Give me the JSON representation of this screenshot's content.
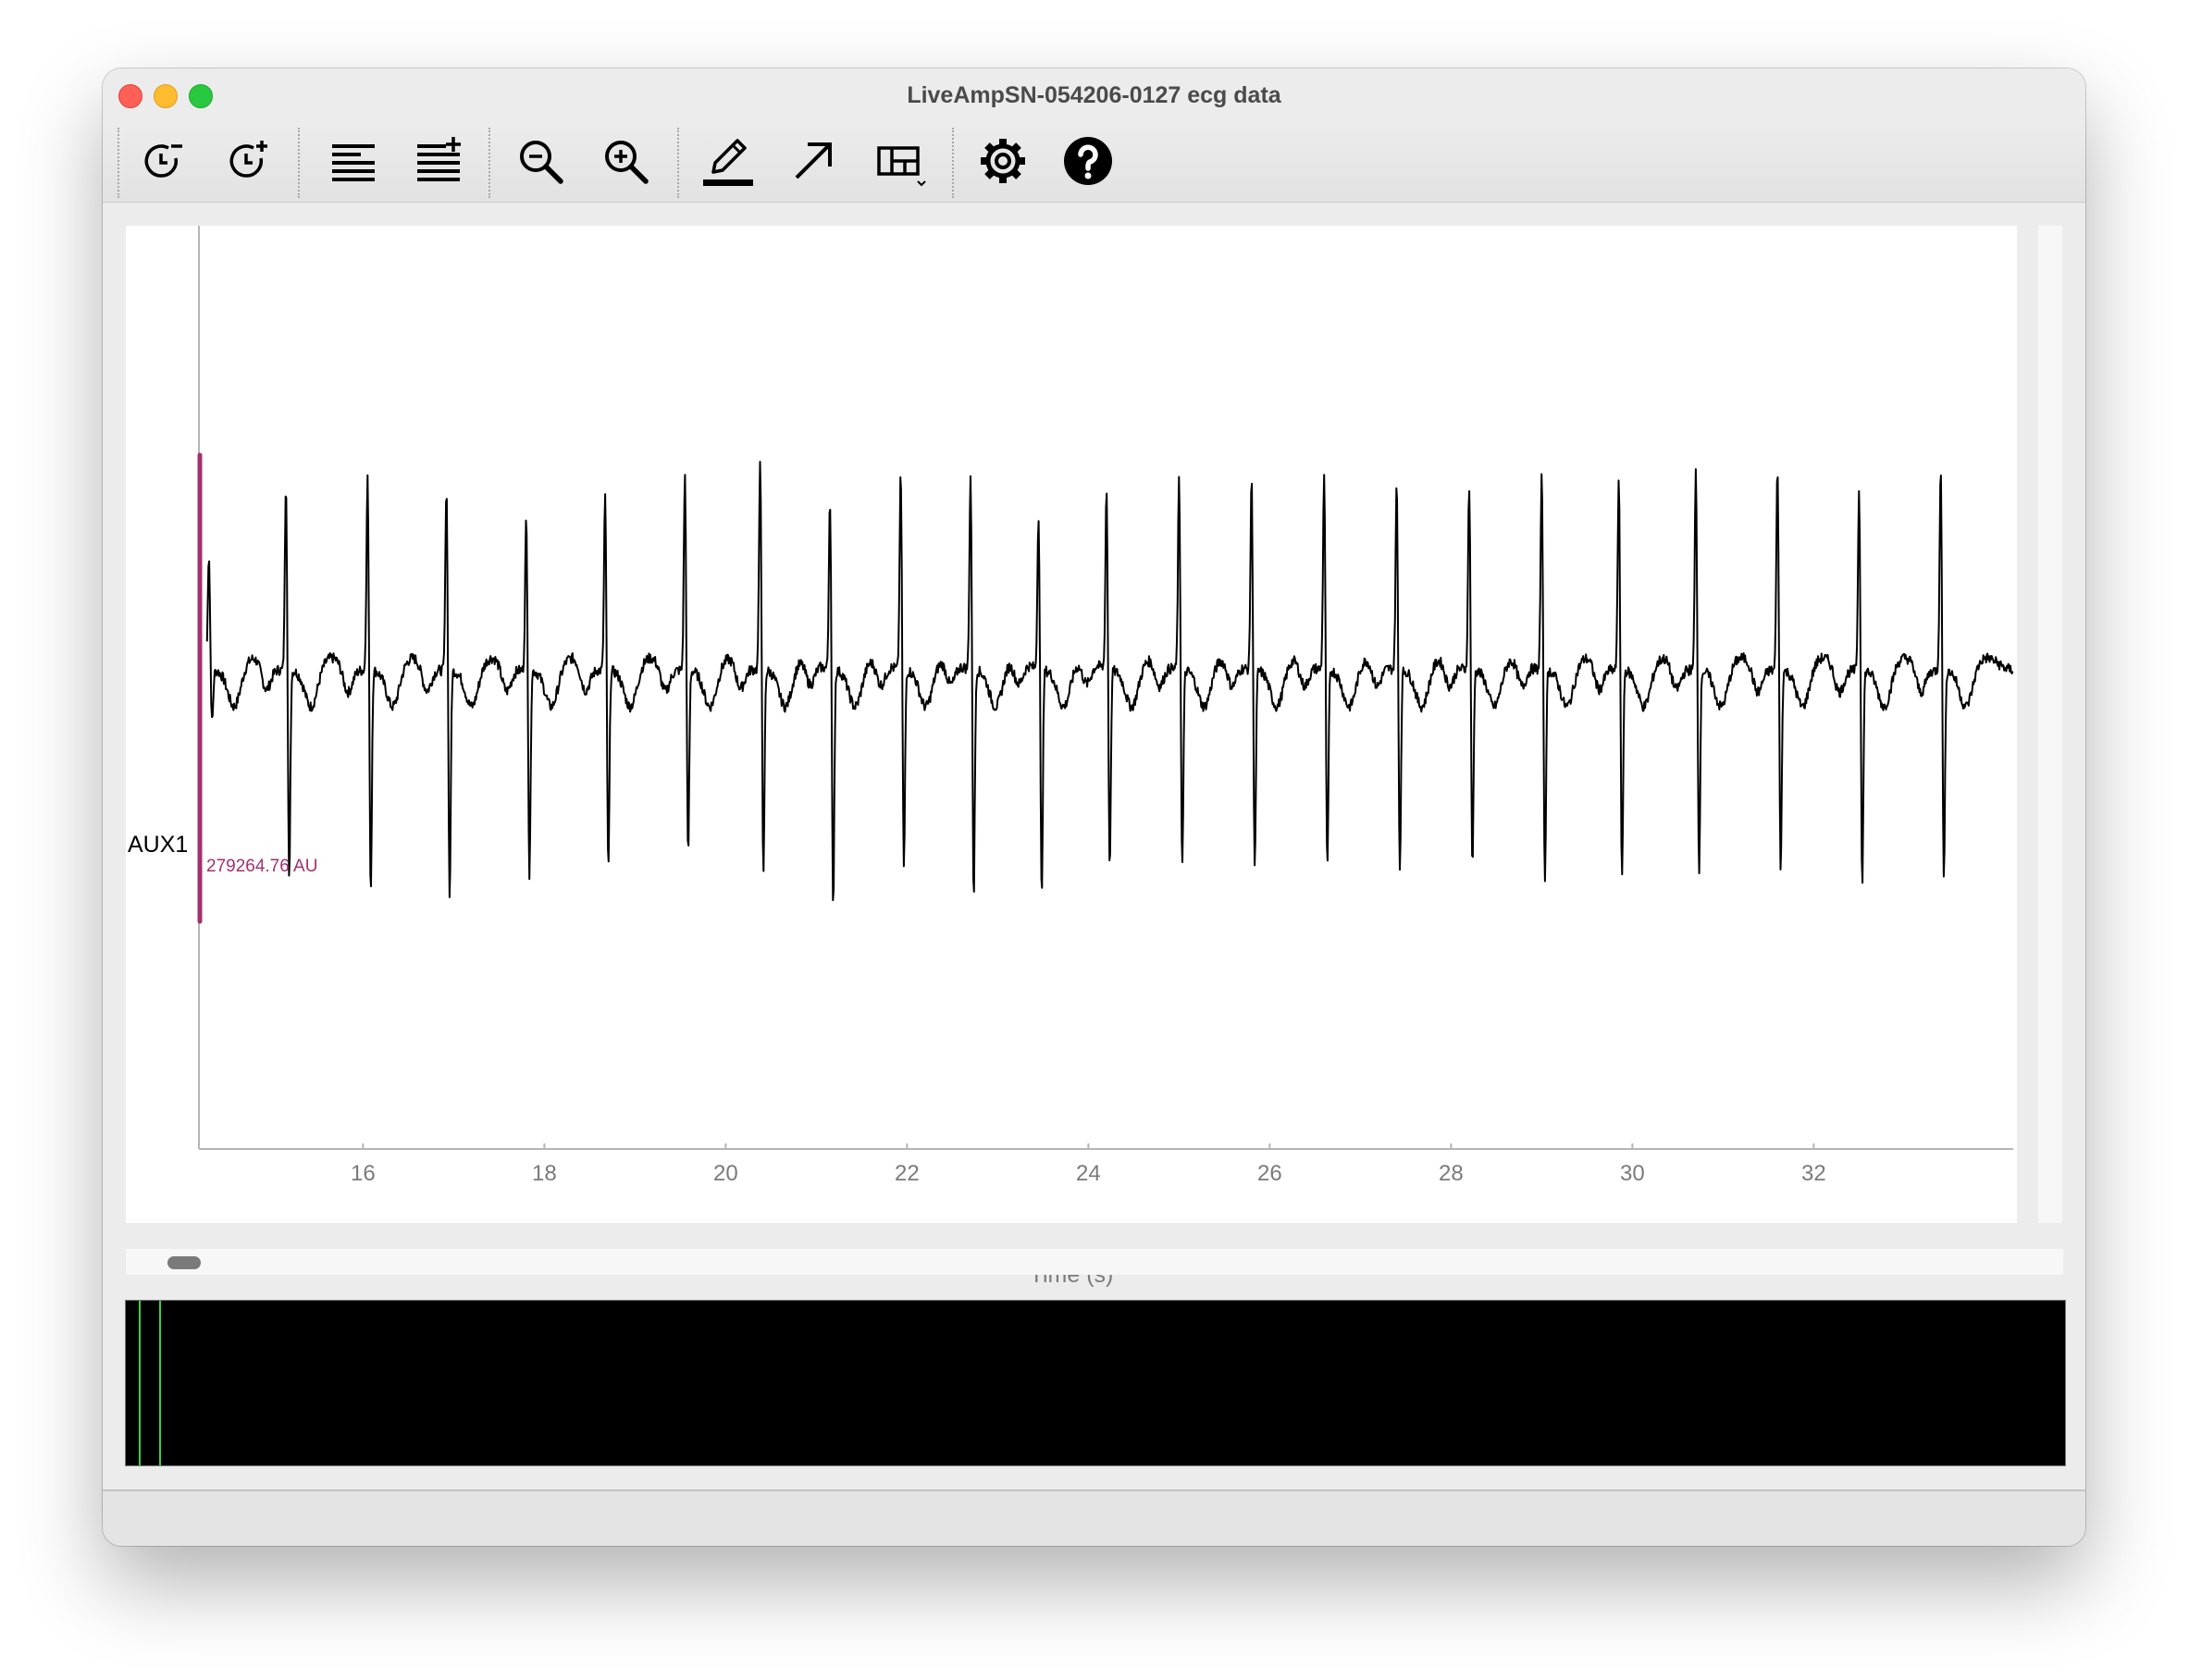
{
  "window": {
    "title": "LiveAmpSN-054206-0127 ecg data"
  },
  "toolbar": {
    "buttons": [
      {
        "name": "decrease-time-scale-button",
        "icon": "clock-minus-icon"
      },
      {
        "name": "increase-time-scale-button",
        "icon": "clock-plus-icon"
      },
      {
        "name": "decrease-channels-button",
        "icon": "lines-icon"
      },
      {
        "name": "increase-channels-button",
        "icon": "lines-plus-icon"
      },
      {
        "name": "zoom-out-button",
        "icon": "zoom-out-icon"
      },
      {
        "name": "zoom-in-button",
        "icon": "zoom-in-icon"
      },
      {
        "name": "annotate-button",
        "icon": "pencil-icon"
      },
      {
        "name": "arrow-button",
        "icon": "arrow-up-right-icon"
      },
      {
        "name": "layout-button",
        "icon": "layout-dropdown-icon"
      },
      {
        "name": "settings-button",
        "icon": "gear-icon"
      },
      {
        "name": "help-button",
        "icon": "help-icon"
      }
    ]
  },
  "plot": {
    "channel": "AUX1",
    "value_label": "279264.76 AU",
    "xlabel": "Time (s)",
    "colors": {
      "trace": "#000000",
      "marker": "#a3306f",
      "overview_marker": "#3cd13c"
    }
  },
  "chart_data": {
    "type": "line",
    "title": "",
    "xlabel": "Time (s)",
    "ylabel": "",
    "xlim": [
      14.2,
      34.2
    ],
    "xticks": [
      "16",
      "18",
      "20",
      "22",
      "24",
      "26",
      "28",
      "30",
      "32"
    ],
    "series": [
      {
        "name": "AUX1",
        "r_peak_times": [
          14.3,
          15.15,
          16.05,
          16.92,
          17.8,
          18.67,
          19.55,
          20.38,
          21.15,
          21.93,
          22.7,
          23.45,
          24.2,
          25.0,
          25.8,
          26.6,
          27.4,
          28.2,
          29.0,
          29.85,
          30.7,
          31.6,
          32.5,
          33.4
        ],
        "r_peak_heights": [
          0.55,
          0.9,
          0.92,
          0.88,
          0.72,
          0.83,
          0.93,
          1.0,
          0.82,
          0.93,
          0.92,
          0.74,
          0.86,
          0.9,
          0.91,
          0.93,
          0.88,
          0.88,
          0.92,
          0.92,
          0.95,
          0.98,
          0.85,
          0.96
        ],
        "s_depths": [
          -0.25,
          -1.0,
          -1.05,
          -1.08,
          -0.98,
          -0.95,
          -0.88,
          -0.98,
          -1.13,
          -0.94,
          -1.07,
          -1.07,
          -0.93,
          -0.93,
          -0.95,
          -0.95,
          -0.95,
          -0.95,
          -1.0,
          -1.0,
          -0.95,
          -0.95,
          -1.0,
          -1.0
        ]
      }
    ],
    "grid": false,
    "legend": "none"
  },
  "overview": {
    "markers": 2
  }
}
